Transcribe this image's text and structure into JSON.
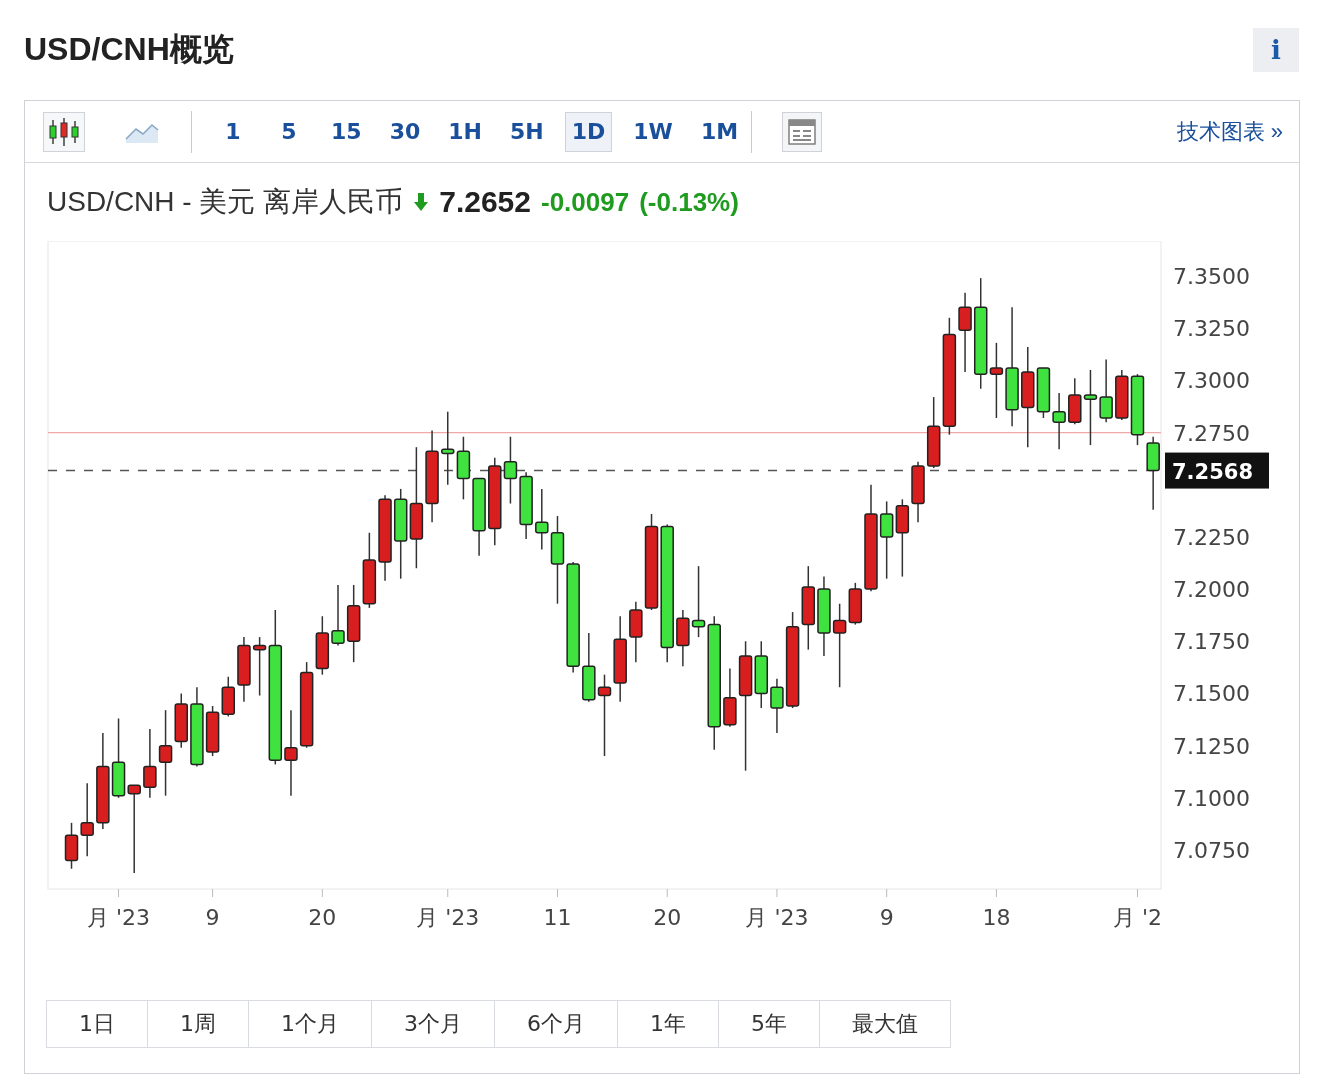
{
  "title": "USD/CNH概览",
  "info_button": "i",
  "toolbar": {
    "chart_types": [
      {
        "kind": "candlestick",
        "selected": true
      },
      {
        "kind": "line",
        "selected": false
      }
    ],
    "intervals": [
      {
        "label": "1",
        "selected": false
      },
      {
        "label": "5",
        "selected": false
      },
      {
        "label": "15",
        "selected": false
      },
      {
        "label": "30",
        "selected": false
      },
      {
        "label": "1H",
        "selected": false
      },
      {
        "label": "5H",
        "selected": false
      },
      {
        "label": "1D",
        "selected": true
      },
      {
        "label": "1W",
        "selected": false
      },
      {
        "label": "1M",
        "selected": false
      }
    ],
    "link": "技术图表 »"
  },
  "quote": {
    "symbol": "USD/CNH - 美元 离岸人民币",
    "price": "7.2652",
    "change": "-0.0097",
    "change_percent": "(-0.13%)"
  },
  "chart_data": {
    "type": "candlestick",
    "ylim": [
      7.0563,
      7.3668
    ],
    "categories": [
      null,
      null,
      null,
      "月 '23",
      null,
      null,
      null,
      null,
      null,
      "9",
      null,
      null,
      null,
      null,
      null,
      null,
      "20",
      null,
      null,
      null,
      null,
      null,
      null,
      null,
      "月 '23",
      null,
      null,
      null,
      null,
      null,
      null,
      "11",
      null,
      null,
      null,
      null,
      null,
      null,
      "20",
      null,
      null,
      null,
      null,
      null,
      null,
      "月 '23",
      null,
      null,
      null,
      null,
      null,
      null,
      "9",
      null,
      null,
      null,
      null,
      null,
      null,
      "18",
      null,
      null,
      null,
      null,
      null,
      null,
      null,
      null,
      "月 '2",
      null
    ],
    "yticks": [
      {
        "value": 7.35,
        "label": "7.3500"
      },
      {
        "value": 7.325,
        "label": "7.3250"
      },
      {
        "value": 7.3,
        "label": "7.3000"
      },
      {
        "value": 7.275,
        "label": "7.2750"
      },
      {
        "value": 7.225,
        "label": "7.2250"
      },
      {
        "value": 7.2,
        "label": "7.2000"
      },
      {
        "value": 7.175,
        "label": "7.1750"
      },
      {
        "value": 7.15,
        "label": "7.1500"
      },
      {
        "value": 7.125,
        "label": "7.1250"
      },
      {
        "value": 7.1,
        "label": "7.1000"
      },
      {
        "value": 7.075,
        "label": "7.0750"
      }
    ],
    "ohlc": [
      [
        7.07,
        7.088,
        7.066,
        7.082
      ],
      [
        7.082,
        7.107,
        7.072,
        7.088
      ],
      [
        7.088,
        7.131,
        7.085,
        7.115
      ],
      [
        7.117,
        7.138,
        7.1,
        7.101
      ],
      [
        7.102,
        7.106,
        7.064,
        7.106
      ],
      [
        7.105,
        7.133,
        7.1,
        7.115
      ],
      [
        7.117,
        7.142,
        7.101,
        7.125
      ],
      [
        7.127,
        7.15,
        7.124,
        7.145
      ],
      [
        7.145,
        7.153,
        7.115,
        7.116
      ],
      [
        7.122,
        7.144,
        7.12,
        7.141
      ],
      [
        7.14,
        7.158,
        7.139,
        7.153
      ],
      [
        7.154,
        7.177,
        7.146,
        7.173
      ],
      [
        7.171,
        7.177,
        7.149,
        7.173
      ],
      [
        7.173,
        7.19,
        7.116,
        7.118
      ],
      [
        7.118,
        7.142,
        7.101,
        7.124
      ],
      [
        7.125,
        7.165,
        7.124,
        7.16
      ],
      [
        7.162,
        7.187,
        7.159,
        7.179
      ],
      [
        7.18,
        7.202,
        7.173,
        7.174
      ],
      [
        7.175,
        7.202,
        7.165,
        7.192
      ],
      [
        7.193,
        7.227,
        7.191,
        7.214
      ],
      [
        7.213,
        7.245,
        7.204,
        7.243
      ],
      [
        7.243,
        7.248,
        7.205,
        7.223
      ],
      [
        7.224,
        7.268,
        7.21,
        7.241
      ],
      [
        7.241,
        7.276,
        7.232,
        7.266
      ],
      [
        7.267,
        7.285,
        7.25,
        7.265
      ],
      [
        7.266,
        7.273,
        7.243,
        7.253
      ],
      [
        7.253,
        7.253,
        7.216,
        7.228
      ],
      [
        7.229,
        7.263,
        7.221,
        7.259
      ],
      [
        7.261,
        7.273,
        7.241,
        7.253
      ],
      [
        7.254,
        7.256,
        7.224,
        7.231
      ],
      [
        7.232,
        7.248,
        7.219,
        7.227
      ],
      [
        7.227,
        7.235,
        7.193,
        7.212
      ],
      [
        7.212,
        7.213,
        7.16,
        7.163
      ],
      [
        7.163,
        7.179,
        7.146,
        7.147
      ],
      [
        7.149,
        7.159,
        7.12,
        7.153
      ],
      [
        7.155,
        7.187,
        7.146,
        7.176
      ],
      [
        7.177,
        7.194,
        7.165,
        7.19
      ],
      [
        7.191,
        7.236,
        7.19,
        7.23
      ],
      [
        7.23,
        7.231,
        7.165,
        7.172
      ],
      [
        7.173,
        7.19,
        7.163,
        7.186
      ],
      [
        7.185,
        7.211,
        7.177,
        7.182
      ],
      [
        7.183,
        7.187,
        7.123,
        7.134
      ],
      [
        7.135,
        7.162,
        7.134,
        7.148
      ],
      [
        7.149,
        7.175,
        7.113,
        7.168
      ],
      [
        7.168,
        7.175,
        7.143,
        7.15
      ],
      [
        7.153,
        7.157,
        7.131,
        7.143
      ],
      [
        7.144,
        7.189,
        7.143,
        7.182
      ],
      [
        7.183,
        7.211,
        7.171,
        7.201
      ],
      [
        7.2,
        7.206,
        7.168,
        7.179
      ],
      [
        7.179,
        7.193,
        7.153,
        7.185
      ],
      [
        7.184,
        7.203,
        7.183,
        7.2
      ],
      [
        7.2,
        7.25,
        7.199,
        7.236
      ],
      [
        7.236,
        7.242,
        7.205,
        7.225
      ],
      [
        7.227,
        7.243,
        7.206,
        7.24
      ],
      [
        7.241,
        7.261,
        7.232,
        7.259
      ],
      [
        7.259,
        7.292,
        7.258,
        7.278
      ],
      [
        7.278,
        7.33,
        7.274,
        7.322
      ],
      [
        7.324,
        7.342,
        7.304,
        7.335
      ],
      [
        7.335,
        7.349,
        7.296,
        7.303
      ],
      [
        7.303,
        7.318,
        7.282,
        7.306
      ],
      [
        7.306,
        7.335,
        7.278,
        7.286
      ],
      [
        7.287,
        7.316,
        7.268,
        7.304
      ],
      [
        7.306,
        7.306,
        7.282,
        7.285
      ],
      [
        7.285,
        7.294,
        7.267,
        7.28
      ],
      [
        7.28,
        7.301,
        7.279,
        7.293
      ],
      [
        7.293,
        7.305,
        7.269,
        7.291
      ],
      [
        7.292,
        7.31,
        7.28,
        7.282
      ],
      [
        7.282,
        7.305,
        7.281,
        7.302
      ],
      [
        7.302,
        7.303,
        7.269,
        7.274
      ],
      [
        7.27,
        7.273,
        7.238,
        7.2568
      ]
    ],
    "ref_lines": [
      {
        "axis": "y",
        "value": 7.275
      },
      {
        "axis": "y",
        "value": 7.2568,
        "label": "7.2568"
      }
    ]
  },
  "ranges": [
    {
      "label": "1日",
      "selected": false
    },
    {
      "label": "1周",
      "selected": false
    },
    {
      "label": "1个月",
      "selected": false
    },
    {
      "label": "3个月",
      "selected": false
    },
    {
      "label": "6个月",
      "selected": false
    },
    {
      "label": "1年",
      "selected": false
    },
    {
      "label": "5年",
      "selected": false
    },
    {
      "label": "最大值",
      "selected": false
    }
  ]
}
